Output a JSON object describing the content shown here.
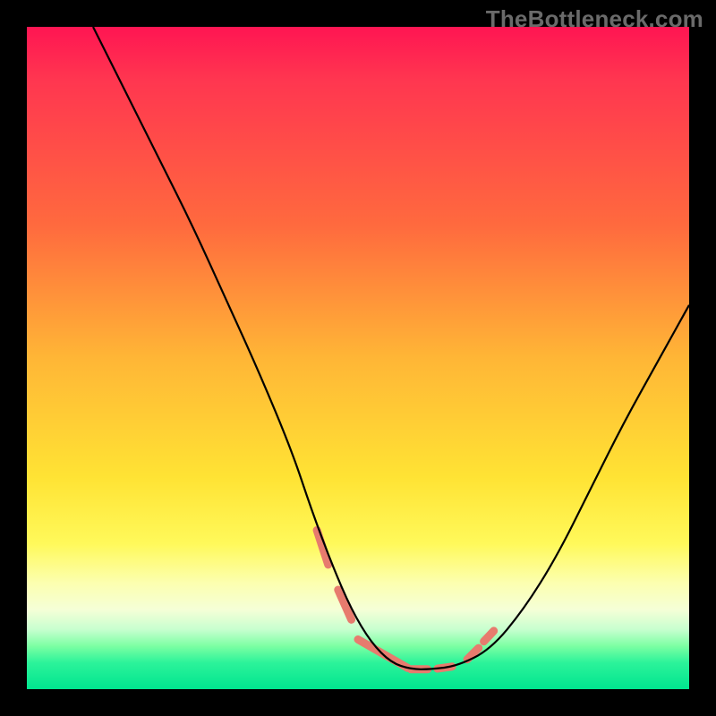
{
  "watermark": "TheBottleneck.com",
  "chart_data": {
    "type": "line",
    "title": "",
    "xlabel": "",
    "ylabel": "",
    "xlim": [
      0,
      100
    ],
    "ylim": [
      0,
      100
    ],
    "grid": false,
    "legend": false,
    "series": [
      {
        "name": "curve-main",
        "color": "#000000",
        "x": [
          10,
          15,
          20,
          25,
          30,
          35,
          40,
          43,
          46,
          49,
          52,
          55,
          58,
          61,
          65,
          70,
          75,
          80,
          85,
          90,
          95,
          100
        ],
        "y": [
          100,
          90,
          80,
          70,
          59,
          48,
          36,
          27,
          19,
          12,
          7,
          4,
          3,
          3,
          3.5,
          6,
          12,
          20,
          30,
          40,
          49,
          58
        ]
      },
      {
        "name": "highlight-dashes",
        "color": "#e77b6e",
        "segments": [
          {
            "x": [
              43.8,
              45.5
            ],
            "y": [
              24.0,
              18.8
            ]
          },
          {
            "x": [
              47.0,
              49.0
            ],
            "y": [
              15.0,
              10.5
            ]
          },
          {
            "x": [
              50.0,
              57.5
            ],
            "y": [
              7.5,
              3.2
            ]
          },
          {
            "x": [
              58.0,
              60.5
            ],
            "y": [
              3.0,
              3.0
            ]
          },
          {
            "x": [
              62.0,
              64.2
            ],
            "y": [
              3.1,
              3.4
            ]
          },
          {
            "x": [
              66.5,
              68.2
            ],
            "y": [
              4.5,
              6.2
            ]
          },
          {
            "x": [
              69.0,
              70.5
            ],
            "y": [
              7.2,
              8.8
            ]
          }
        ]
      }
    ],
    "background_gradient": {
      "direction": "vertical",
      "stops": [
        {
          "pos": 0,
          "color": "#ff1552"
        },
        {
          "pos": 30,
          "color": "#ff6a3e"
        },
        {
          "pos": 50,
          "color": "#ffb636"
        },
        {
          "pos": 68,
          "color": "#ffe334"
        },
        {
          "pos": 84,
          "color": "#fcffb0"
        },
        {
          "pos": 93,
          "color": "#7CFFA3"
        },
        {
          "pos": 100,
          "color": "#00e58f"
        }
      ]
    }
  }
}
